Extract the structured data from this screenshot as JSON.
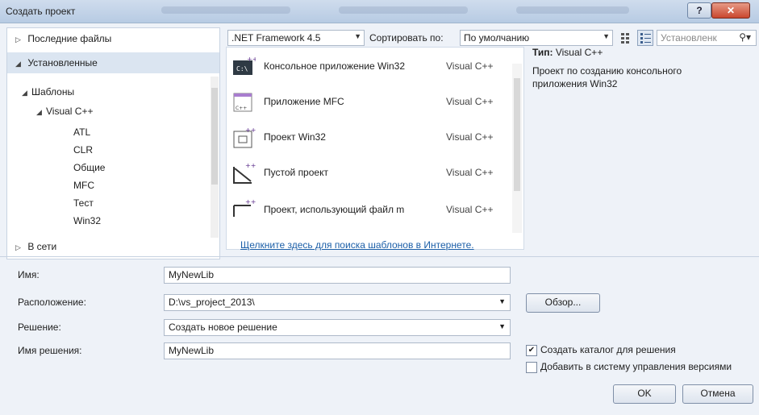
{
  "window": {
    "title": "Создать проект"
  },
  "left": {
    "recent": "Последние файлы",
    "installed": "Установленные",
    "templates": "Шаблоны",
    "visual_cpp": "Visual C++",
    "children": [
      "ATL",
      "CLR",
      "Общие",
      "MFC",
      "Тест",
      "Win32"
    ],
    "online": "В сети"
  },
  "toolbar": {
    "framework": ".NET Framework 4.5",
    "sort_label": "Сортировать по:",
    "sort_value": "По умолчанию",
    "search_placeholder": "Установленк"
  },
  "templates": [
    {
      "name": "Консольное приложение Win32",
      "lang": "Visual C++",
      "icon": "console-app-icon"
    },
    {
      "name": "Приложение MFC",
      "lang": "Visual C++",
      "icon": "mfc-app-icon"
    },
    {
      "name": "Проект Win32",
      "lang": "Visual C++",
      "icon": "win32-project-icon"
    },
    {
      "name": "Пустой проект",
      "lang": "Visual C++",
      "icon": "empty-project-icon"
    },
    {
      "name": "Проект, использующий файл m",
      "lang": "Visual C++",
      "icon": "makefile-project-icon"
    }
  ],
  "online_link": "Щелкните здесь для поиска шаблонов в Интернете.",
  "details": {
    "type_label": "Тип:",
    "type_value": "Visual C++",
    "description": "Проект по созданию консольного приложения Win32"
  },
  "form": {
    "name_label": "Имя:",
    "name_value": "MyNewLib",
    "location_label": "Расположение:",
    "location_value": "D:\\vs_project_2013\\",
    "solution_label": "Решение:",
    "solution_value": "Создать новое решение",
    "solution_name_label": "Имя решения:",
    "solution_name_value": "MyNewLib",
    "browse": "Обзор...",
    "create_dir": "Создать каталог для решения",
    "add_vcs": "Добавить в систему управления версиями",
    "ok": "OK",
    "cancel": "Отмена"
  }
}
